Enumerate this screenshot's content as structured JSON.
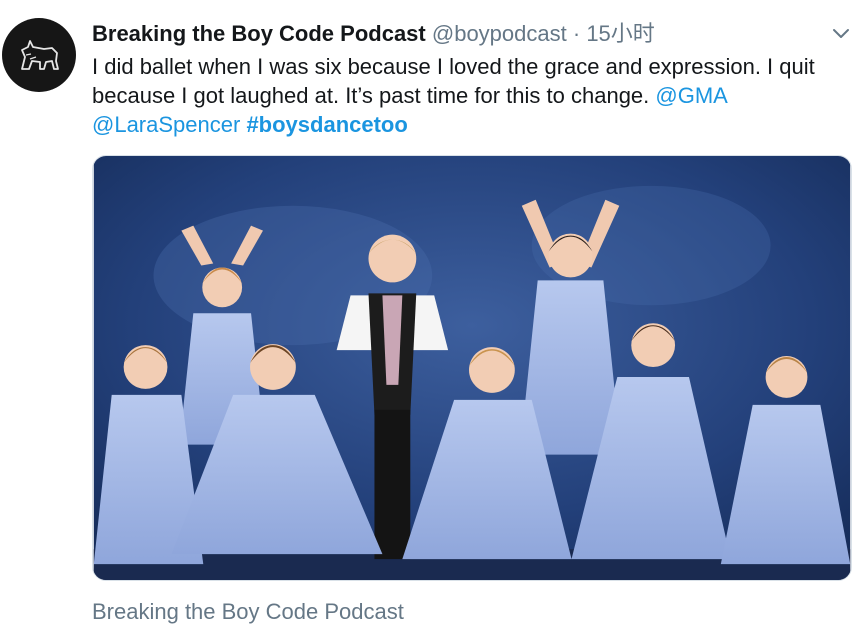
{
  "author": {
    "display_name": "Breaking the Boy Code Podcast",
    "handle": "@boypodcast",
    "separator": "·",
    "timestamp": "15小时",
    "avatar_icon": "wolf-icon"
  },
  "tweet": {
    "text_line": "I did ballet when I was six because I loved the grace and expression. I quit because I got laughed at. It’s past time for this to change.",
    "mention_1": "@GMA",
    "mention_2": "@LaraSpencer",
    "hashtag": "#boysdancetoo"
  },
  "media": {
    "type": "photo"
  },
  "source_label": "Breaking the Boy Code Podcast",
  "colors": {
    "link": "#1b95e0",
    "text": "#14171a",
    "secondary": "#657786",
    "dress": "#9fb4e0",
    "backdrop": "#1e3466"
  }
}
